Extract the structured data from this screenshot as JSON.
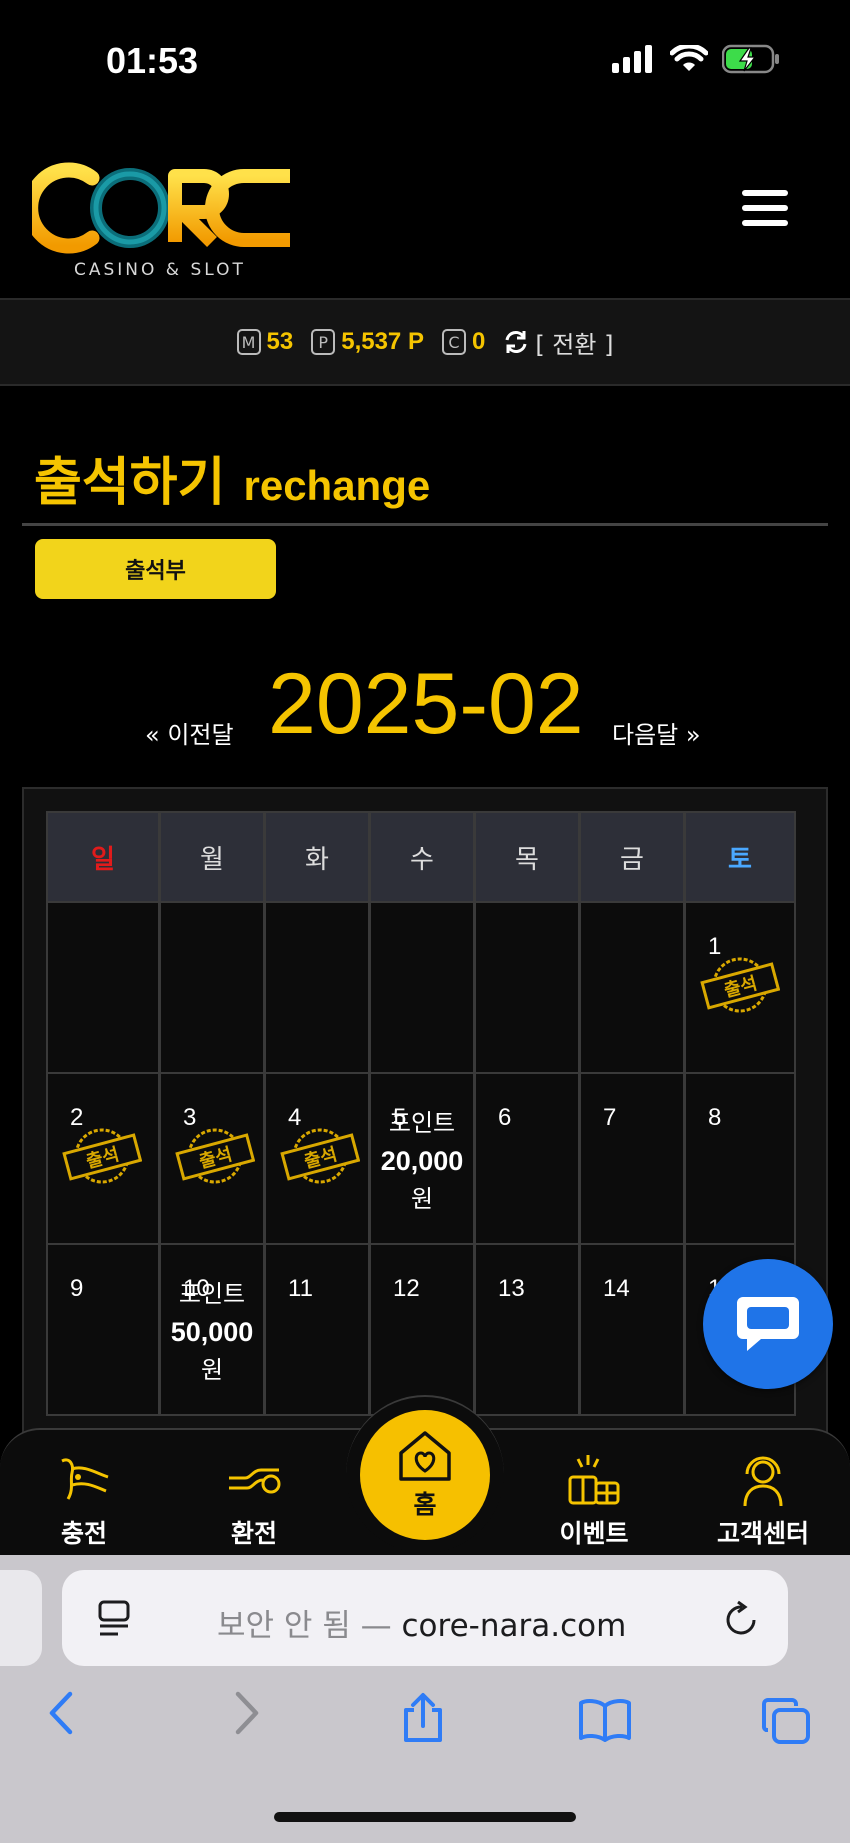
{
  "status_bar": {
    "time": "01:53"
  },
  "header": {
    "logo_word": "CORE",
    "logo_sub": "CASINO & SLOT",
    "colors": {
      "accent": "#f5c400"
    }
  },
  "points": {
    "m_badge": "M",
    "m_value": "53",
    "p_badge": "P",
    "p_value": "5,537 P",
    "c_badge": "C",
    "c_value": "0",
    "switch_label": "[ 전환 ]"
  },
  "page": {
    "title_ko": "출석하기",
    "title_en": "rechange",
    "attendance_button": "출석부"
  },
  "month_nav": {
    "prev": "« 이전달",
    "current": "2025-02",
    "next": "다음달 »"
  },
  "calendar": {
    "weekdays": [
      "일",
      "월",
      "화",
      "수",
      "목",
      "금",
      "토"
    ],
    "stamp_label": "출석",
    "weeks": [
      [
        {
          "day": ""
        },
        {
          "day": ""
        },
        {
          "day": ""
        },
        {
          "day": ""
        },
        {
          "day": ""
        },
        {
          "day": ""
        },
        {
          "day": "1",
          "stamp": true
        }
      ],
      [
        {
          "day": "2",
          "stamp": true
        },
        {
          "day": "3",
          "stamp": true
        },
        {
          "day": "4",
          "stamp": true
        },
        {
          "day": "5",
          "reward_line1": "포인트",
          "reward_amount": "20,000",
          "reward_unit": "원"
        },
        {
          "day": "6"
        },
        {
          "day": "7"
        },
        {
          "day": "8"
        }
      ],
      [
        {
          "day": "9"
        },
        {
          "day": "10",
          "reward_line1": "포인트",
          "reward_amount": "50,000",
          "reward_unit": "원"
        },
        {
          "day": "11"
        },
        {
          "day": "12"
        },
        {
          "day": "13"
        },
        {
          "day": "14"
        },
        {
          "day": "15"
        }
      ]
    ]
  },
  "bottom_nav": {
    "items": [
      {
        "label": "충전",
        "icon": "deposit-icon"
      },
      {
        "label": "환전",
        "icon": "exchange-icon"
      },
      {
        "label": "홈",
        "icon": "home-heart-icon"
      },
      {
        "label": "이벤트",
        "icon": "gift-icon"
      },
      {
        "label": "고객센터",
        "icon": "support-agent-icon"
      }
    ]
  },
  "browser": {
    "url_prefix": "보안 안 됨 — ",
    "url_host": "core-nara.com"
  }
}
